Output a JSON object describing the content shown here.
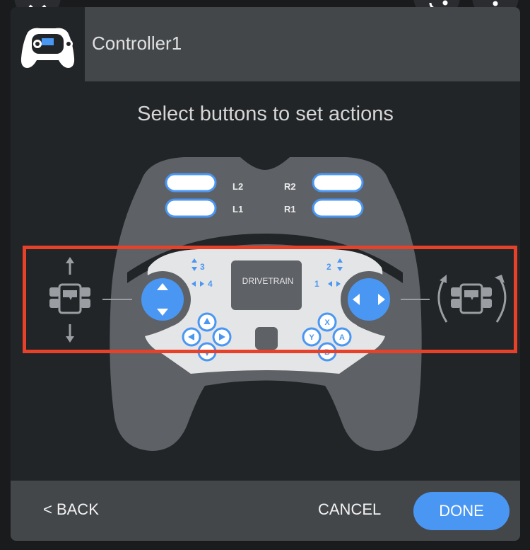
{
  "header": {
    "controller_name": "Controller1",
    "icon": "gamepad-icon"
  },
  "instruction": "Select buttons to set actions",
  "controller": {
    "bumpers": [
      {
        "label": "L2",
        "side": "left"
      },
      {
        "label": "L1",
        "side": "left"
      },
      {
        "label": "R2",
        "side": "right"
      },
      {
        "label": "R1",
        "side": "right"
      }
    ],
    "axis_labels": {
      "axis3": "3",
      "axis4": "4",
      "axis2": "2",
      "axis1": "1"
    },
    "screen_label": "DRIVETRAIN",
    "face_buttons": [
      "X",
      "Y",
      "A",
      "B"
    ],
    "dpad": [
      "up",
      "left",
      "right",
      "down"
    ],
    "left_action": "drive-forward-backward-icon",
    "right_action": "turn-rotate-icon"
  },
  "footer": {
    "back_label": "< BACK",
    "cancel_label": "CANCEL",
    "done_label": "DONE"
  },
  "colors": {
    "accent": "#4a97f3",
    "highlight": "#e8412a",
    "panel": "#222528",
    "header": "#44474a"
  }
}
